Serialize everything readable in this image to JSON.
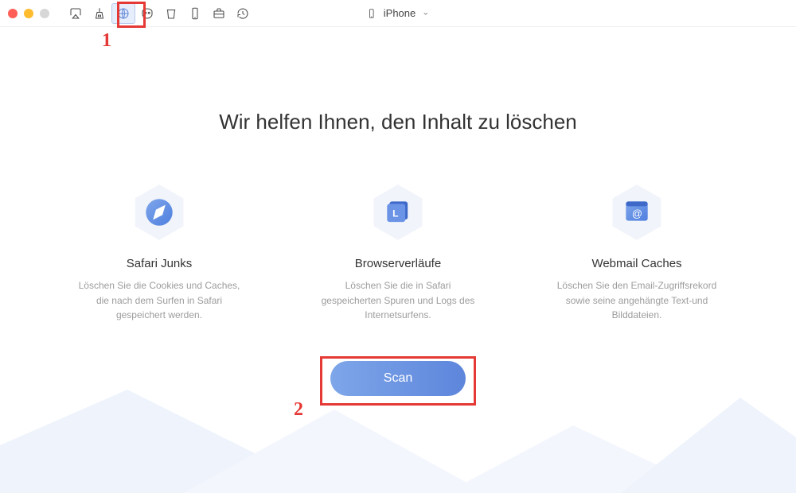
{
  "device_picker": {
    "label": "iPhone"
  },
  "headline": "Wir helfen Ihnen, den Inhalt zu löschen",
  "cards": {
    "safari": {
      "title": "Safari Junks",
      "desc": "Löschen Sie die Cookies und Caches, die nach dem Surfen in Safari gespeichert werden."
    },
    "history": {
      "title": "Browserverläufe",
      "desc": "Löschen Sie die in Safari gespeicherten Spuren und Logs des Internetsurfens."
    },
    "webmail": {
      "title": "Webmail Caches",
      "desc": "Löschen Sie den Email-Zugriffsrekord sowie seine angehängte Text-und Bilddateien."
    }
  },
  "scan_button": "Scan",
  "annotations": {
    "one": "1",
    "two": "2"
  },
  "colors": {
    "accent": "#5d86dc",
    "annotation": "#e53935"
  }
}
